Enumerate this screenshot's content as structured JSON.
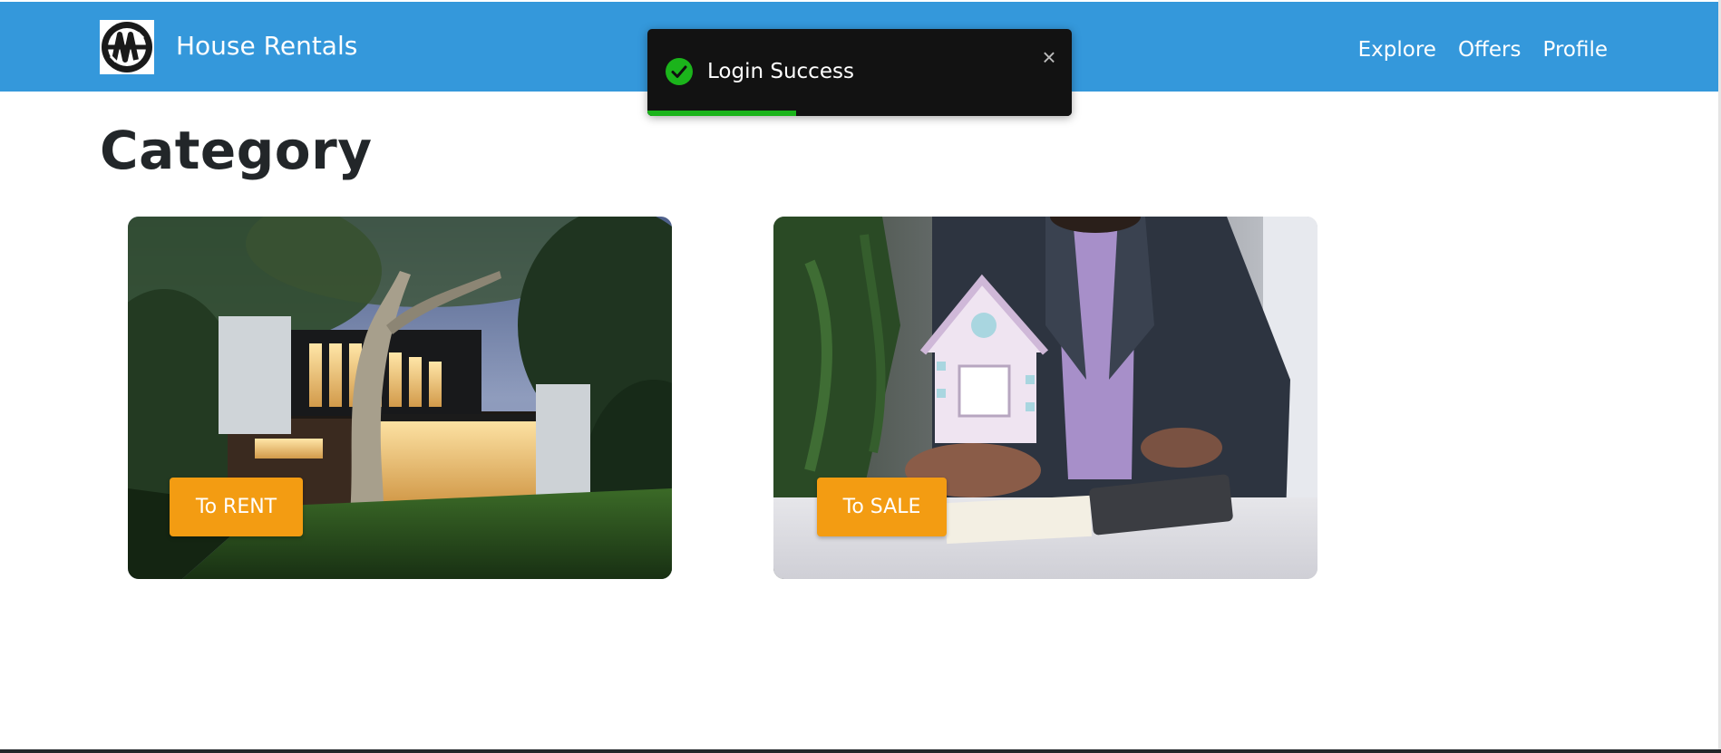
{
  "header": {
    "brand_title": "House Rentals",
    "logo_icon": "monogram-logo-icon",
    "nav": [
      {
        "label": "Explore"
      },
      {
        "label": "Offers"
      },
      {
        "label": "Profile"
      }
    ]
  },
  "main": {
    "title": "Category",
    "cards": [
      {
        "label": "To RENT",
        "image": "modern-house-at-dusk-photo"
      },
      {
        "label": "To SALE",
        "image": "hand-holding-toy-house-photo"
      }
    ]
  },
  "toast": {
    "message": "Login Success",
    "icon": "check-circle-icon",
    "close_label": "×",
    "progress": 0.35
  },
  "colors": {
    "navbar": "#3498db",
    "accent_button": "#f39c12",
    "toast_bg": "#121212",
    "toast_progress": "#1bb41b",
    "title_text": "#222629"
  }
}
